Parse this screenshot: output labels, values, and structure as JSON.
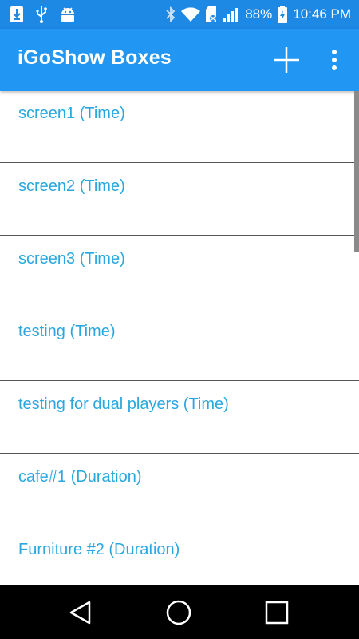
{
  "status_bar": {
    "battery": "88%",
    "time": "10:46 PM",
    "icons": [
      "download-icon",
      "usb-icon",
      "android-icon",
      "bluetooth-icon",
      "wifi-icon",
      "sd-card-icon",
      "signal-icon",
      "battery-charging-icon"
    ]
  },
  "app_bar": {
    "title": "iGoShow Boxes",
    "actions": [
      "add-icon",
      "more-vert-icon"
    ]
  },
  "list": {
    "items": [
      {
        "label": "screen1 (Time)"
      },
      {
        "label": "screen2 (Time)"
      },
      {
        "label": "screen3 (Time)"
      },
      {
        "label": "testing (Time)"
      },
      {
        "label": "testing for dual players (Time)"
      },
      {
        "label": "cafe#1 (Duration)"
      },
      {
        "label": "Furniture #2 (Duration)"
      }
    ]
  },
  "nav_bar": {
    "buttons": [
      "back-icon",
      "home-icon",
      "recents-icon"
    ]
  },
  "colors": {
    "status_bar": "#1e88e5",
    "app_bar": "#2196f3",
    "item_text": "#29a8e0",
    "divider": "#555555",
    "nav_bar": "#000000"
  }
}
